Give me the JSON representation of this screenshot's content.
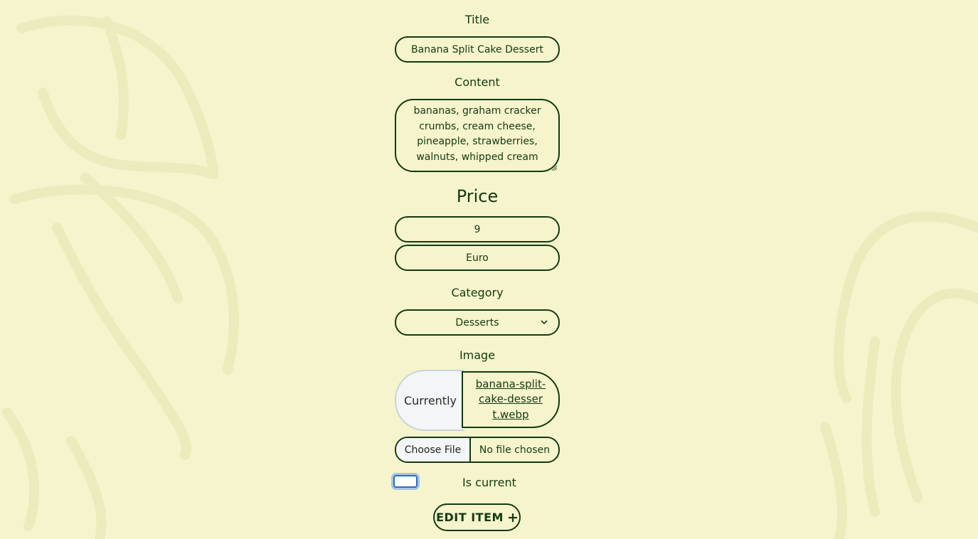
{
  "form": {
    "title_label": "Title",
    "title_value": "Banana Split Cake Dessert",
    "content_label": "Content",
    "content_value": "bananas, graham cracker crumbs, cream cheese, pineapple, strawberries, walnuts, whipped cream",
    "price_label": "Price",
    "price_value": "9",
    "currency_value": "Euro",
    "category_label": "Category",
    "category_selected": "Desserts",
    "image_label": "Image",
    "currently_label": "Currently",
    "current_image_link": "banana-split-cake-dessert.webp",
    "file_button_label": "Choose File",
    "file_status": "No file chosen",
    "is_current_label": "Is current",
    "is_current_checked": false,
    "submit_label": "EDIT ITEM"
  },
  "icons": {
    "select_chevron": "chevron-down-icon",
    "submit_plus": "plus-icon",
    "textarea_grip": "resize-grip-icon"
  },
  "colors": {
    "background": "#f6f4cc",
    "foreground": "#123a12",
    "decoration": "#ecebbe",
    "focus_ring": "#a9c3e6"
  }
}
